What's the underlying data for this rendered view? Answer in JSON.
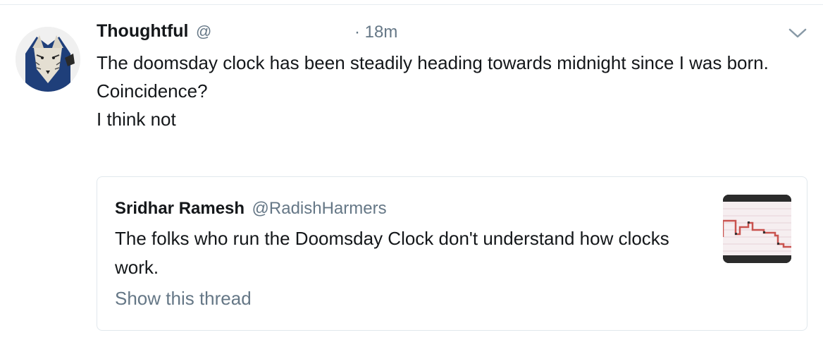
{
  "tweet": {
    "author_name": "Thoughtful",
    "author_handle": "@",
    "time": "· 18m",
    "text_lines": [
      "The doomsday clock has been steadily heading towards midnight since I was born.",
      "Coincidence?",
      "I think not"
    ],
    "icons": {
      "avatar": "wolf-avatar-icon",
      "menu": "chevron-down-icon"
    }
  },
  "quoted": {
    "author_name": "Sridhar Ramesh",
    "author_handle": "@RadishHarmers",
    "text": "The folks who run the Doomsday Clock don't understand how clocks work.",
    "show_thread": "Show this thread",
    "thumbnail_icon": "doomsday-chart-thumbnail"
  },
  "colors": {
    "text_primary": "#14171a",
    "text_secondary": "#657786",
    "border": "#e1e8ed"
  }
}
